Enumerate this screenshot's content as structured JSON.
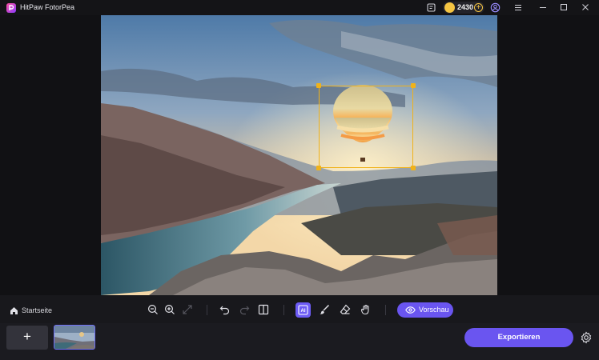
{
  "app": {
    "title": "HitPaw FotorPea",
    "logo_icon": "p-logo"
  },
  "titlebar": {
    "icons": [
      "notes-icon",
      "user-icon",
      "menu-icon"
    ],
    "credits": {
      "value": "2430",
      "coin_color": "#f5c542"
    },
    "window_controls": [
      "minimize",
      "maximize",
      "close"
    ]
  },
  "canvas": {
    "image_description_icon": "hot-air-balloon-landscape",
    "selection_color": "#f0b21a"
  },
  "toolbar": {
    "home_label": "Startseite",
    "tools": [
      "zoom-out",
      "zoom-in",
      "fit-screen",
      "undo",
      "redo",
      "compare",
      "ai-select",
      "brush",
      "eraser",
      "hand"
    ],
    "preview_label": "Vorschau"
  },
  "bottom": {
    "add_label": "+",
    "export_label": "Exportieren",
    "accent": "#6a55f0"
  }
}
